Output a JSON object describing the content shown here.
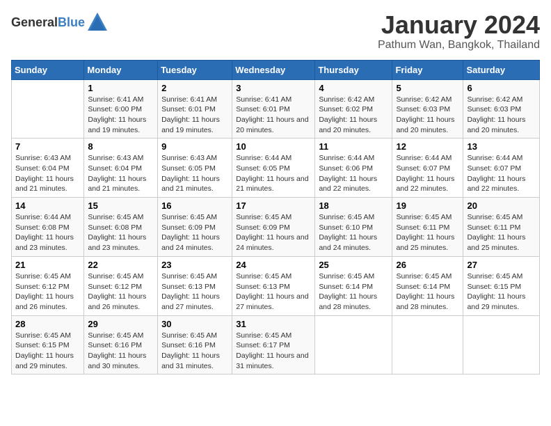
{
  "logo": {
    "general": "General",
    "blue": "Blue"
  },
  "title": "January 2024",
  "subtitle": "Pathum Wan, Bangkok, Thailand",
  "weekdays": [
    "Sunday",
    "Monday",
    "Tuesday",
    "Wednesday",
    "Thursday",
    "Friday",
    "Saturday"
  ],
  "weeks": [
    [
      {
        "day": "",
        "sunrise": "",
        "sunset": "",
        "daylight": ""
      },
      {
        "day": "1",
        "sunrise": "Sunrise: 6:41 AM",
        "sunset": "Sunset: 6:00 PM",
        "daylight": "Daylight: 11 hours and 19 minutes."
      },
      {
        "day": "2",
        "sunrise": "Sunrise: 6:41 AM",
        "sunset": "Sunset: 6:01 PM",
        "daylight": "Daylight: 11 hours and 19 minutes."
      },
      {
        "day": "3",
        "sunrise": "Sunrise: 6:41 AM",
        "sunset": "Sunset: 6:01 PM",
        "daylight": "Daylight: 11 hours and 20 minutes."
      },
      {
        "day": "4",
        "sunrise": "Sunrise: 6:42 AM",
        "sunset": "Sunset: 6:02 PM",
        "daylight": "Daylight: 11 hours and 20 minutes."
      },
      {
        "day": "5",
        "sunrise": "Sunrise: 6:42 AM",
        "sunset": "Sunset: 6:03 PM",
        "daylight": "Daylight: 11 hours and 20 minutes."
      },
      {
        "day": "6",
        "sunrise": "Sunrise: 6:42 AM",
        "sunset": "Sunset: 6:03 PM",
        "daylight": "Daylight: 11 hours and 20 minutes."
      }
    ],
    [
      {
        "day": "7",
        "sunrise": "Sunrise: 6:43 AM",
        "sunset": "Sunset: 6:04 PM",
        "daylight": "Daylight: 11 hours and 21 minutes."
      },
      {
        "day": "8",
        "sunrise": "Sunrise: 6:43 AM",
        "sunset": "Sunset: 6:04 PM",
        "daylight": "Daylight: 11 hours and 21 minutes."
      },
      {
        "day": "9",
        "sunrise": "Sunrise: 6:43 AM",
        "sunset": "Sunset: 6:05 PM",
        "daylight": "Daylight: 11 hours and 21 minutes."
      },
      {
        "day": "10",
        "sunrise": "Sunrise: 6:44 AM",
        "sunset": "Sunset: 6:05 PM",
        "daylight": "Daylight: 11 hours and 21 minutes."
      },
      {
        "day": "11",
        "sunrise": "Sunrise: 6:44 AM",
        "sunset": "Sunset: 6:06 PM",
        "daylight": "Daylight: 11 hours and 22 minutes."
      },
      {
        "day": "12",
        "sunrise": "Sunrise: 6:44 AM",
        "sunset": "Sunset: 6:07 PM",
        "daylight": "Daylight: 11 hours and 22 minutes."
      },
      {
        "day": "13",
        "sunrise": "Sunrise: 6:44 AM",
        "sunset": "Sunset: 6:07 PM",
        "daylight": "Daylight: 11 hours and 22 minutes."
      }
    ],
    [
      {
        "day": "14",
        "sunrise": "Sunrise: 6:44 AM",
        "sunset": "Sunset: 6:08 PM",
        "daylight": "Daylight: 11 hours and 23 minutes."
      },
      {
        "day": "15",
        "sunrise": "Sunrise: 6:45 AM",
        "sunset": "Sunset: 6:08 PM",
        "daylight": "Daylight: 11 hours and 23 minutes."
      },
      {
        "day": "16",
        "sunrise": "Sunrise: 6:45 AM",
        "sunset": "Sunset: 6:09 PM",
        "daylight": "Daylight: 11 hours and 24 minutes."
      },
      {
        "day": "17",
        "sunrise": "Sunrise: 6:45 AM",
        "sunset": "Sunset: 6:09 PM",
        "daylight": "Daylight: 11 hours and 24 minutes."
      },
      {
        "day": "18",
        "sunrise": "Sunrise: 6:45 AM",
        "sunset": "Sunset: 6:10 PM",
        "daylight": "Daylight: 11 hours and 24 minutes."
      },
      {
        "day": "19",
        "sunrise": "Sunrise: 6:45 AM",
        "sunset": "Sunset: 6:11 PM",
        "daylight": "Daylight: 11 hours and 25 minutes."
      },
      {
        "day": "20",
        "sunrise": "Sunrise: 6:45 AM",
        "sunset": "Sunset: 6:11 PM",
        "daylight": "Daylight: 11 hours and 25 minutes."
      }
    ],
    [
      {
        "day": "21",
        "sunrise": "Sunrise: 6:45 AM",
        "sunset": "Sunset: 6:12 PM",
        "daylight": "Daylight: 11 hours and 26 minutes."
      },
      {
        "day": "22",
        "sunrise": "Sunrise: 6:45 AM",
        "sunset": "Sunset: 6:12 PM",
        "daylight": "Daylight: 11 hours and 26 minutes."
      },
      {
        "day": "23",
        "sunrise": "Sunrise: 6:45 AM",
        "sunset": "Sunset: 6:13 PM",
        "daylight": "Daylight: 11 hours and 27 minutes."
      },
      {
        "day": "24",
        "sunrise": "Sunrise: 6:45 AM",
        "sunset": "Sunset: 6:13 PM",
        "daylight": "Daylight: 11 hours and 27 minutes."
      },
      {
        "day": "25",
        "sunrise": "Sunrise: 6:45 AM",
        "sunset": "Sunset: 6:14 PM",
        "daylight": "Daylight: 11 hours and 28 minutes."
      },
      {
        "day": "26",
        "sunrise": "Sunrise: 6:45 AM",
        "sunset": "Sunset: 6:14 PM",
        "daylight": "Daylight: 11 hours and 28 minutes."
      },
      {
        "day": "27",
        "sunrise": "Sunrise: 6:45 AM",
        "sunset": "Sunset: 6:15 PM",
        "daylight": "Daylight: 11 hours and 29 minutes."
      }
    ],
    [
      {
        "day": "28",
        "sunrise": "Sunrise: 6:45 AM",
        "sunset": "Sunset: 6:15 PM",
        "daylight": "Daylight: 11 hours and 29 minutes."
      },
      {
        "day": "29",
        "sunrise": "Sunrise: 6:45 AM",
        "sunset": "Sunset: 6:16 PM",
        "daylight": "Daylight: 11 hours and 30 minutes."
      },
      {
        "day": "30",
        "sunrise": "Sunrise: 6:45 AM",
        "sunset": "Sunset: 6:16 PM",
        "daylight": "Daylight: 11 hours and 31 minutes."
      },
      {
        "day": "31",
        "sunrise": "Sunrise: 6:45 AM",
        "sunset": "Sunset: 6:17 PM",
        "daylight": "Daylight: 11 hours and 31 minutes."
      },
      {
        "day": "",
        "sunrise": "",
        "sunset": "",
        "daylight": ""
      },
      {
        "day": "",
        "sunrise": "",
        "sunset": "",
        "daylight": ""
      },
      {
        "day": "",
        "sunrise": "",
        "sunset": "",
        "daylight": ""
      }
    ]
  ]
}
